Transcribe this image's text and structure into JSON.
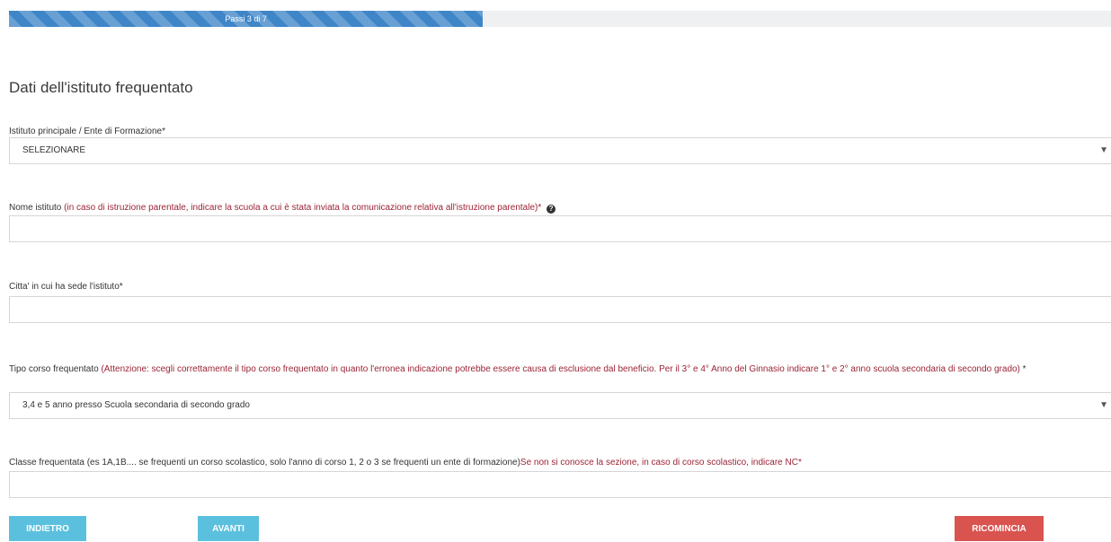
{
  "progress": {
    "label": "Passi 3 di 7",
    "percent": 43
  },
  "section": {
    "title": "Dati dell'istituto frequentato"
  },
  "fields": {
    "istituto": {
      "label": "Istituto principale / Ente di Formazione*",
      "selected": "SELEZIONARE"
    },
    "nome_istituto": {
      "label": "Nome istituto",
      "hint": "(in caso di istruzione parentale, indicare la scuola a cui è stata inviata la comunicazione relativa all'istruzione parentale)*",
      "info_icon": "question-circle-icon",
      "value": ""
    },
    "citta": {
      "label": "Citta' in cui ha sede l'istituto*",
      "value": ""
    },
    "tipo_corso": {
      "label": "Tipo corso frequentato",
      "hint": "(Attenzione: scegli correttamente il tipo corso frequentato in quanto l'erronea indicazione potrebbe essere causa di esclusione dal beneficio. Per il 3° e 4° Anno del Ginnasio indicare 1° e 2° anno scuola secondaria di secondo grado)",
      "required_mark": " *",
      "selected": "3,4 e 5 anno presso Scuola secondaria di secondo grado"
    },
    "classe": {
      "label": "Classe frequentata (es 1A,1B.... se frequenti un corso scolastico, solo l'anno di corso 1, 2 o 3 se frequenti un ente di formazione)",
      "hint": "Se non si conosce la sezione, in caso di corso scolastico, indicare NC*",
      "value": ""
    }
  },
  "buttons": {
    "back": "INDIETRO",
    "next": "AVANTI",
    "restart": "RICOMINCIA"
  },
  "colors": {
    "progress": "#3f86c8",
    "hint_text": "#9b2335",
    "info_button": "#5bc0de",
    "danger_button": "#d9534f"
  }
}
